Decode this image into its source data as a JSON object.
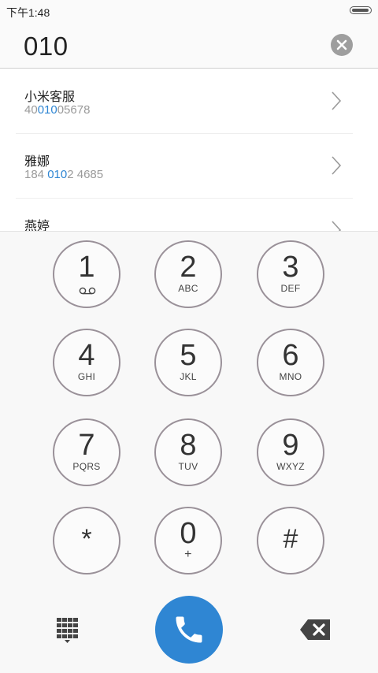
{
  "status_bar": {
    "time": "下午1:48"
  },
  "dial_input": {
    "value": "010"
  },
  "results": [
    {
      "name": "小米客服",
      "num_before": "40",
      "num_match": "010",
      "num_after": "05678"
    },
    {
      "name": "雅娜",
      "num_before": "184 ",
      "num_match": "010",
      "num_after": "2 4685"
    },
    {
      "name": "燕婷",
      "num_before": "",
      "num_match": "",
      "num_after": ""
    }
  ],
  "keypad": {
    "k1": {
      "digit": "1",
      "letters": ""
    },
    "k2": {
      "digit": "2",
      "letters": "ABC"
    },
    "k3": {
      "digit": "3",
      "letters": "DEF"
    },
    "k4": {
      "digit": "4",
      "letters": "GHI"
    },
    "k5": {
      "digit": "5",
      "letters": "JKL"
    },
    "k6": {
      "digit": "6",
      "letters": "MNO"
    },
    "k7": {
      "digit": "7",
      "letters": "PQRS"
    },
    "k8": {
      "digit": "8",
      "letters": "TUV"
    },
    "k9": {
      "digit": "9",
      "letters": "WXYZ"
    },
    "kstar": {
      "digit": "*",
      "letters": ""
    },
    "k0": {
      "digit": "0",
      "letters": "+"
    },
    "khash": {
      "digit": "#",
      "letters": ""
    }
  },
  "icons": {
    "voicemail": "voicemail-icon",
    "keypad_toggle": "keypad-grid-icon",
    "call": "phone-icon",
    "backspace": "backspace-icon",
    "clear": "clear-icon",
    "chevron": "chevron-right-icon"
  },
  "colors": {
    "accent": "#2f86d3",
    "key_border": "#9a9199",
    "muted": "#9a9a9a"
  }
}
